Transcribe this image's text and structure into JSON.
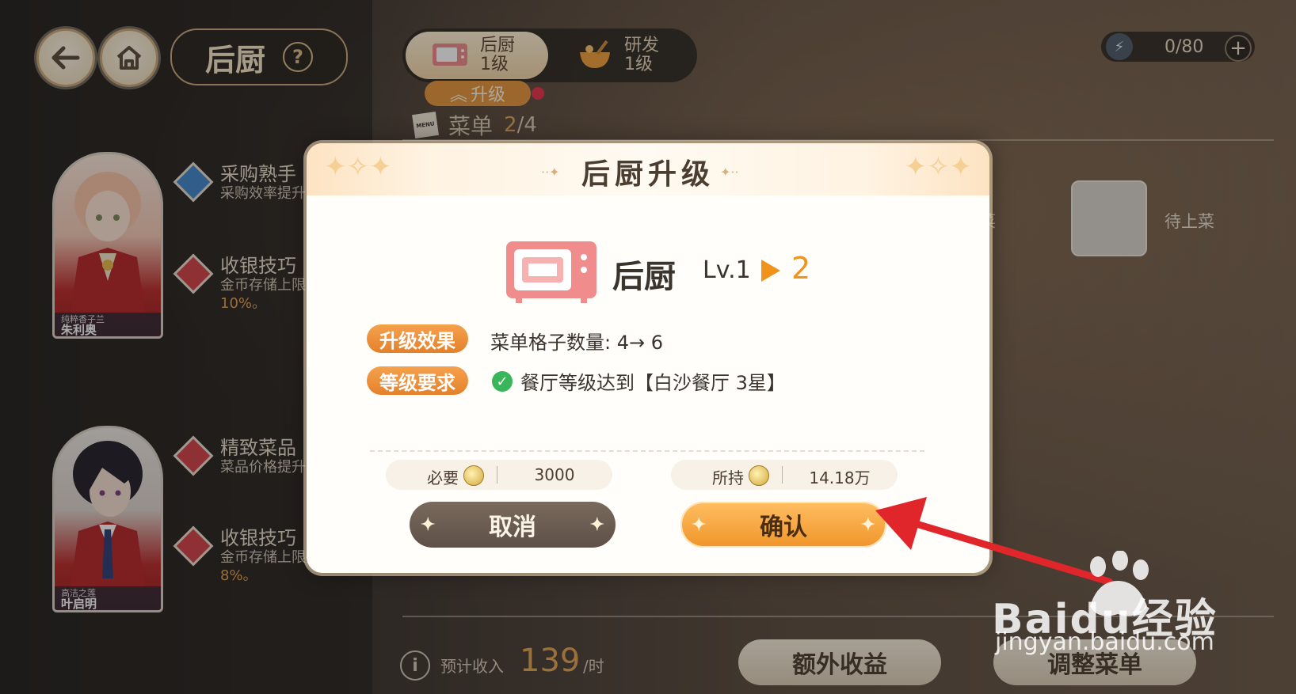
{
  "topbar": {
    "title": "后厨",
    "help_glyph": "?",
    "back_icon": "arrow-left-icon",
    "home_icon": "home-icon"
  },
  "tabs": [
    {
      "label": "后厨\n1级",
      "icon": "microwave-icon",
      "active": true
    },
    {
      "label": "研发\n1级",
      "icon": "mixing-bowl-icon",
      "active": false
    }
  ],
  "upgrade_tag": "升级",
  "menu": {
    "label": "菜单",
    "count_current": "2",
    "count_total": "/4",
    "icon_text": "MENU"
  },
  "energy": {
    "value": "0/80",
    "plus": "+"
  },
  "characters": [
    {
      "title": "纯粹香子兰",
      "name": "朱利奥",
      "skills": [
        {
          "name": "采购熟手",
          "desc": "采购效率提升",
          "value": ""
        },
        {
          "name": "收银技巧",
          "desc": "金币存储上限",
          "value": "10%。"
        }
      ]
    },
    {
      "title": "高洁之莲",
      "name": "叶启明",
      "skills": [
        {
          "name": "精致菜品",
          "desc": "菜品价格提升",
          "value": ""
        },
        {
          "name": "收银技巧",
          "desc": "金币存储上限提高",
          "value": "8%。"
        }
      ]
    }
  ],
  "side_slots": {
    "partial_label": "菜",
    "label": "待上菜"
  },
  "bottom": {
    "income_label": "预计收入",
    "income_value": "139",
    "income_unit": "/时",
    "extra_button": "额外收益",
    "adjust_button": "调整菜单"
  },
  "modal": {
    "title": "后厨升级",
    "facility_name": "后厨",
    "level_from": "Lv.1",
    "level_to": "2",
    "effect_tag": "升级效果",
    "effect_text": "菜单格子数量: 4→ 6",
    "requirement_tag": "等级要求",
    "requirement_text": "餐厅等级达到【白沙餐厅 3星】",
    "required_label": "必要",
    "required_value": "3000",
    "owned_label": "所持",
    "owned_value": "14.18万",
    "cancel_button": "取消",
    "confirm_button": "确认"
  },
  "watermark": {
    "text": "Baidu经验",
    "url": "jingyan.baidu.com"
  },
  "colors": {
    "accent_orange": "#f0931a",
    "annotation_red": "#e0262b",
    "confirm_gold": "#ffbe62"
  }
}
